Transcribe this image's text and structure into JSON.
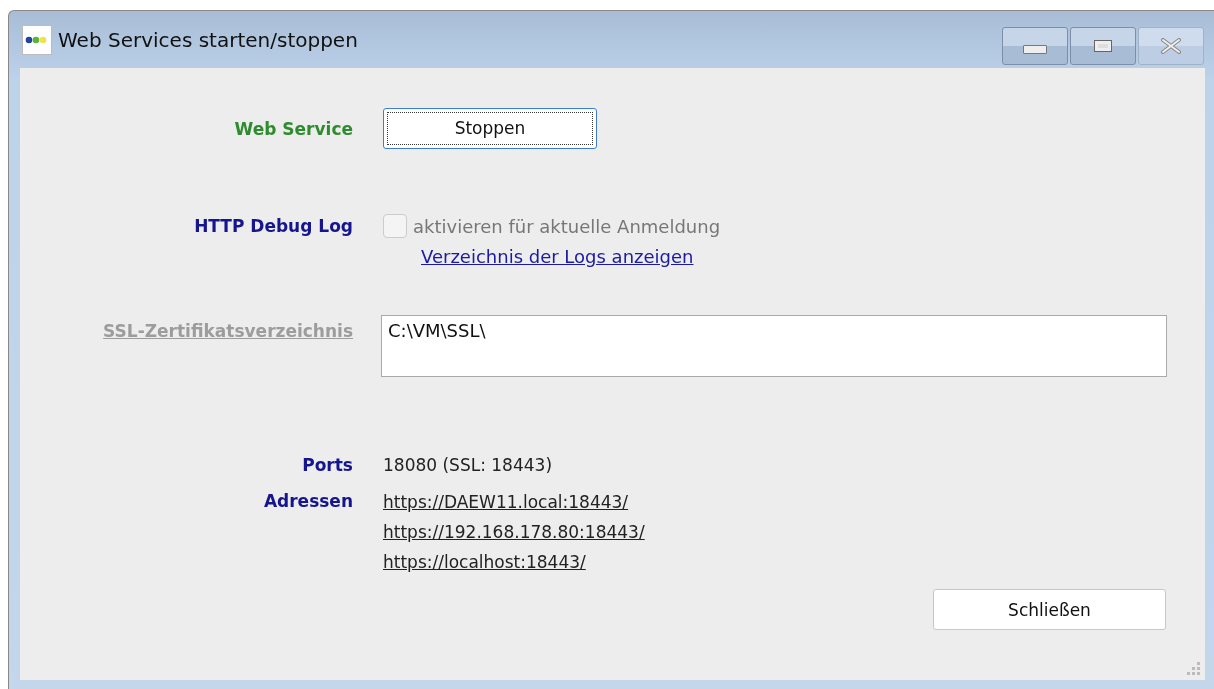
{
  "window": {
    "title": "Web Services starten/stoppen"
  },
  "web_service": {
    "label": "Web Service",
    "running": true,
    "button": "Stoppen"
  },
  "debug_log": {
    "label": "HTTP Debug Log",
    "checkbox": {
      "label": "aktivieren für aktuelle Anmeldung",
      "checked": false,
      "disabled": true
    },
    "link": "Verzeichnis der Logs anzeigen"
  },
  "ssl": {
    "label": "SSL-Zertifikatsverzeichnis",
    "disabled": true,
    "value": "C:\\VM\\SSL\\"
  },
  "ports": {
    "label": "Ports",
    "value": "18080 (SSL: 18443)"
  },
  "addresses": {
    "label": "Adressen",
    "links": [
      "https://DAEW11.local:18443/",
      "https://192.168.178.80:18443/",
      "https://localhost:18443/"
    ]
  },
  "buttons": {
    "close": "Schließen"
  }
}
